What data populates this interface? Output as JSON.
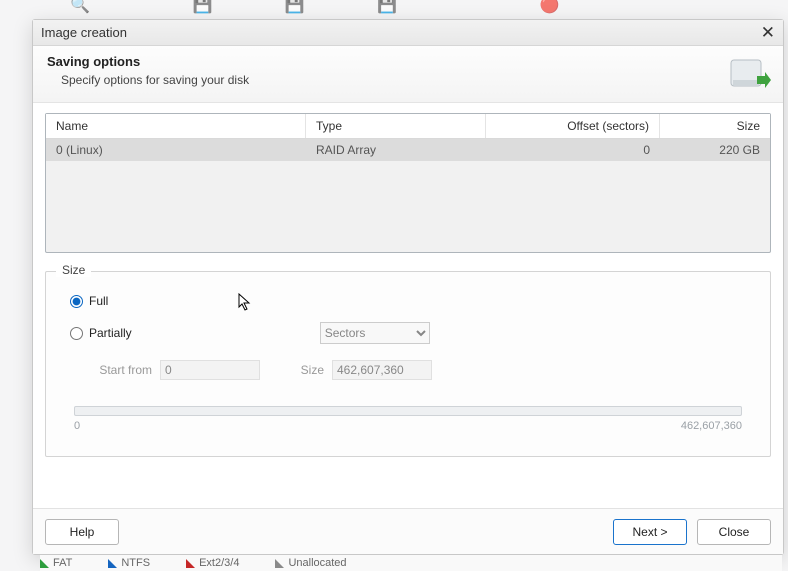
{
  "dialog": {
    "title": "Image creation",
    "header_title": "Saving options",
    "header_sub": "Specify options for saving your disk"
  },
  "table": {
    "headers": {
      "name": "Name",
      "type": "Type",
      "offset": "Offset (sectors)",
      "size": "Size"
    },
    "row": {
      "name": "0 (Linux)",
      "type": "RAID Array",
      "offset": "0",
      "size": "220 GB"
    }
  },
  "size_group": {
    "legend": "Size",
    "full_label": "Full",
    "partially_label": "Partially",
    "unit_selected": "Sectors",
    "unit_options": [
      "Sectors"
    ],
    "start_from_label": "Start from",
    "start_from_value": "0",
    "size_label": "Size",
    "size_value": "462,607,360",
    "slider_min": "0",
    "slider_max": "462,607,360"
  },
  "buttons": {
    "help": "Help",
    "next": "Next >",
    "close": "Close"
  },
  "fs_legend": {
    "fat": "FAT",
    "ntfs": "NTFS",
    "ext": "Ext2/3/4",
    "unalloc": "Unallocated"
  }
}
